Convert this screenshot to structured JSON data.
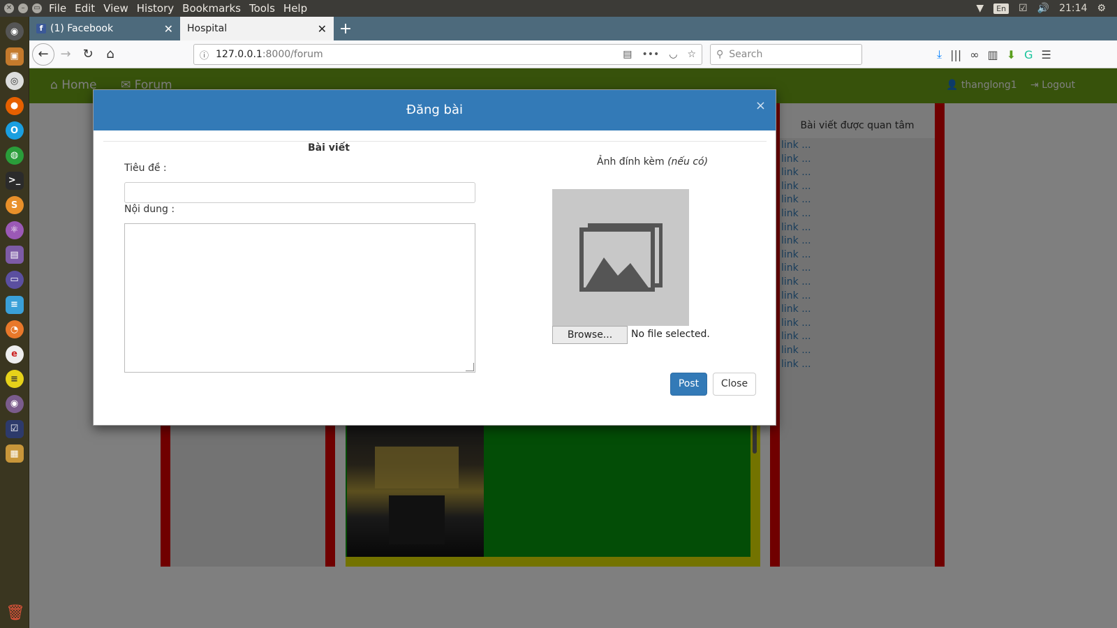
{
  "system": {
    "menus": [
      "File",
      "Edit",
      "View",
      "History",
      "Bookmarks",
      "Tools",
      "Help"
    ],
    "keyboard": "En",
    "clock": "21:14"
  },
  "tabs": [
    {
      "label": "(1) Facebook"
    },
    {
      "label": "Hospital"
    }
  ],
  "urlbar": {
    "host": "127.0.0.1",
    "path": ":8000/forum"
  },
  "search": {
    "placeholder": "Search"
  },
  "site": {
    "nav_home": "Home",
    "nav_forum": "Forum",
    "user": "thanglong1",
    "logout": "Logout",
    "right_header": "Bài viết được quan tâm",
    "link_text": "link ...",
    "accent_green": "#6fa516"
  },
  "modal": {
    "title": "Đăng bài",
    "close_symbol": "×",
    "section_title": "Bài viết",
    "title_label": "Tiêu đề :",
    "content_label": "Nội dung :",
    "attach_label": "Ảnh đính kèm",
    "attach_optional": "(nếu có)",
    "browse_label": "Browse...",
    "no_file": "No file selected.",
    "post_label": "Post",
    "close_label": "Close",
    "header_color": "#337ab7"
  }
}
